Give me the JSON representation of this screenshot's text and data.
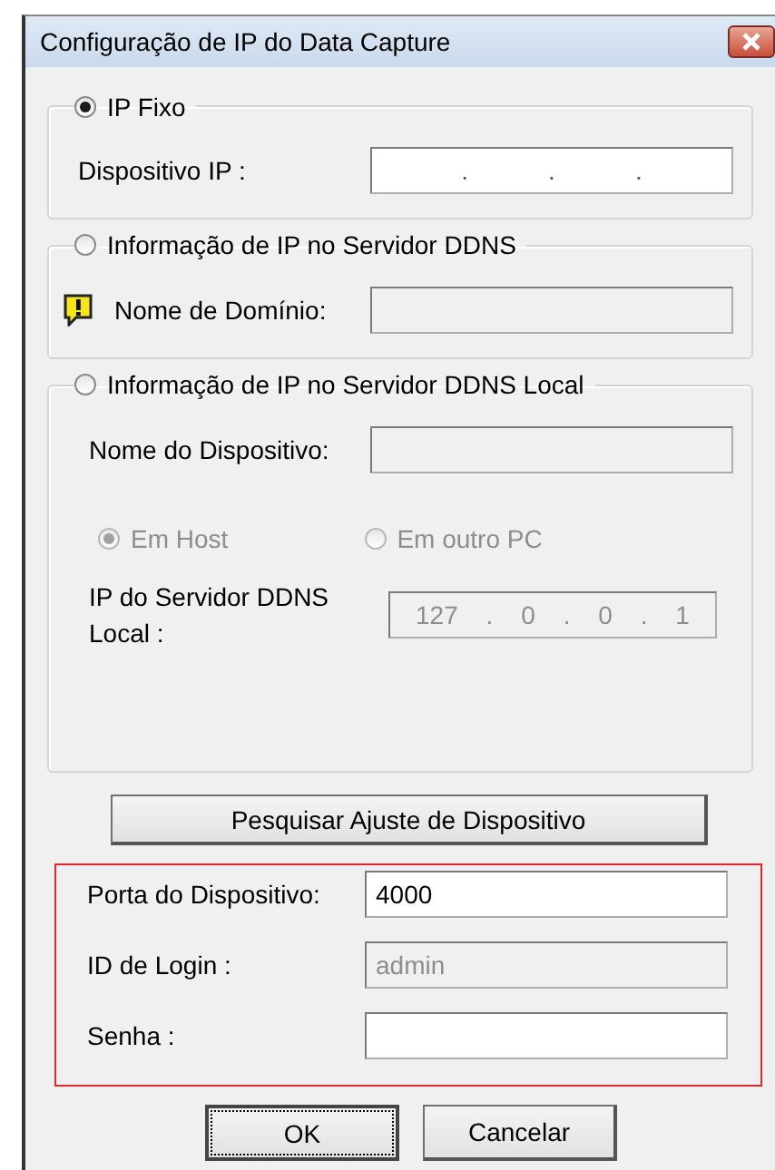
{
  "window": {
    "title": "Configuração de IP do Data Capture"
  },
  "groups": [
    {
      "label": "IP Fixo",
      "selected": true,
      "rows": [
        {
          "kind": "ip",
          "label": "Dispositivo IP :",
          "parts": [
            ".",
            ".",
            "."
          ],
          "disabled": false
        }
      ]
    },
    {
      "label": "Informação de IP no Servidor DDNS",
      "selected": false,
      "rows": [
        {
          "kind": "text",
          "label": "Nome de Domínio:",
          "disabled": true,
          "warning": true
        }
      ]
    },
    {
      "label": "Informação de IP no Servidor DDNS Local",
      "selected": false,
      "rows": [
        {
          "kind": "text",
          "label": "Nome do Dispositivo:",
          "disabled": true
        },
        {
          "kind": "radios",
          "options": [
            {
              "label": "Em Host",
              "selected": true,
              "disabled": true
            },
            {
              "label": "Em outro PC",
              "selected": false,
              "disabled": true
            }
          ]
        },
        {
          "kind": "ip",
          "label": "IP do Servidor DDNS Local :",
          "parts": [
            "127",
            ".",
            "0",
            ".",
            "0",
            ".",
            "1"
          ],
          "disabled": true
        }
      ]
    }
  ],
  "search_button": "Pesquisar Ajuste de Dispositivo",
  "login": {
    "highlighted": true,
    "rows": [
      {
        "label": "Porta do Dispositivo:",
        "value": "4000",
        "disabled": false
      },
      {
        "label": "ID de Login :",
        "value": "admin",
        "disabled": true
      },
      {
        "label": "Senha :",
        "disabled": false
      }
    ]
  },
  "buttons": [
    {
      "label": "OK",
      "focused": true
    },
    {
      "label": "Cancelar",
      "focused": false
    }
  ]
}
